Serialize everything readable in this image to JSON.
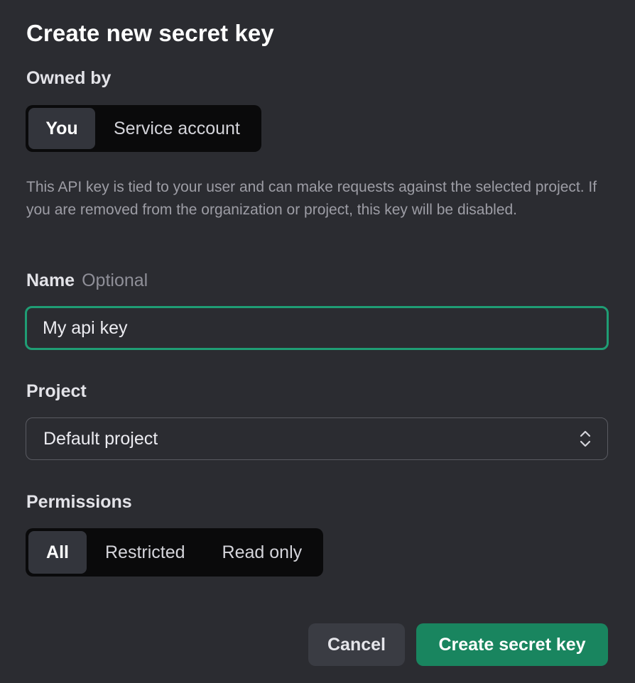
{
  "dialog": {
    "title": "Create new secret key"
  },
  "owned_by": {
    "label": "Owned by",
    "options": [
      "You",
      "Service account"
    ],
    "selected": "You",
    "help_text": "This API key is tied to your user and can make requests against the selected project. If you are removed from the organization or project, this key will be disabled."
  },
  "name": {
    "label": "Name",
    "optional_label": "Optional",
    "value": "My api key",
    "focus_color": "#1f9d74"
  },
  "project": {
    "label": "Project",
    "selected": "Default project"
  },
  "permissions": {
    "label": "Permissions",
    "options": [
      "All",
      "Restricted",
      "Read only"
    ],
    "selected": "All"
  },
  "actions": {
    "cancel_label": "Cancel",
    "create_label": "Create secret key",
    "create_color": "#19855f"
  }
}
